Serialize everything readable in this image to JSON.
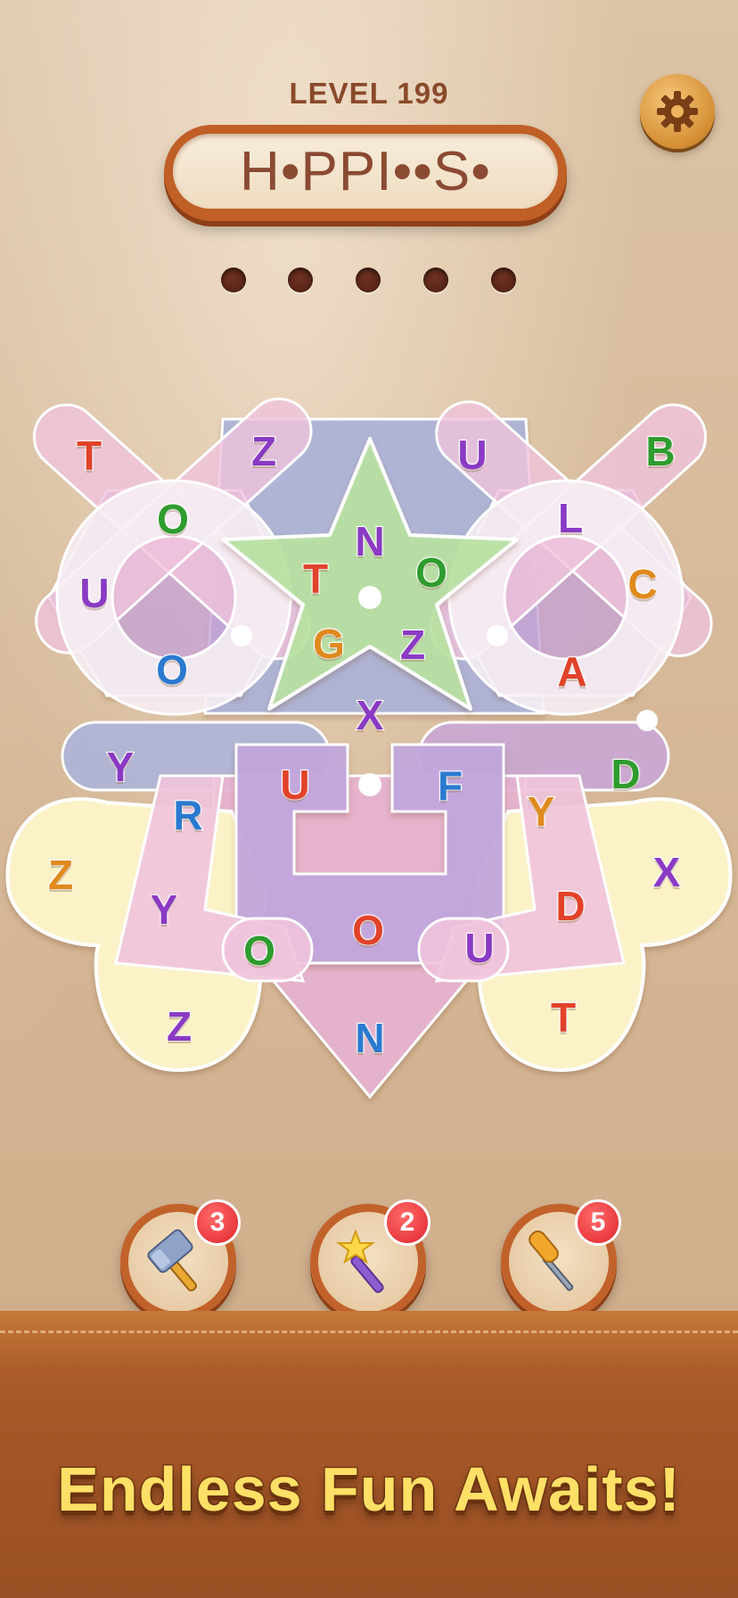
{
  "header": {
    "level_label": "LEVEL 199",
    "word_pattern": "H•PPI••S•",
    "settings_icon": "gear-icon"
  },
  "slots": {
    "count": 5
  },
  "board": {
    "letters": [
      {
        "char": "T",
        "color": "#e2422a"
      },
      {
        "char": "Z",
        "color": "#8a3ac4"
      },
      {
        "char": "U",
        "color": "#8a3ac4"
      },
      {
        "char": "B",
        "color": "#2e9c2e"
      },
      {
        "char": "O",
        "color": "#2e9c2e"
      },
      {
        "char": "N",
        "color": "#8a3ac4"
      },
      {
        "char": "L",
        "color": "#8a3ac4"
      },
      {
        "char": "U",
        "color": "#8a3ac4"
      },
      {
        "char": "T",
        "color": "#e2422a"
      },
      {
        "char": "O",
        "color": "#2e9c2e"
      },
      {
        "char": "C",
        "color": "#e08a1e"
      },
      {
        "char": "O",
        "color": "#2a7ad0"
      },
      {
        "char": "G",
        "color": "#e08a1e"
      },
      {
        "char": "Z",
        "color": "#8a3ac4"
      },
      {
        "char": "A",
        "color": "#e2422a"
      },
      {
        "char": "X",
        "color": "#8a3ac4"
      },
      {
        "char": "Y",
        "color": "#8a3ac4"
      },
      {
        "char": "U",
        "color": "#e2422a"
      },
      {
        "char": "F",
        "color": "#2a7ad0"
      },
      {
        "char": "D",
        "color": "#2e9c2e"
      },
      {
        "char": "R",
        "color": "#2a7ad0"
      },
      {
        "char": "Y",
        "color": "#e08a1e"
      },
      {
        "char": "Z",
        "color": "#e08a1e"
      },
      {
        "char": "X",
        "color": "#8a3ac4"
      },
      {
        "char": "Y",
        "color": "#8a3ac4"
      },
      {
        "char": "D",
        "color": "#e2422a"
      },
      {
        "char": "O",
        "color": "#2e9c2e"
      },
      {
        "char": "O",
        "color": "#e2422a"
      },
      {
        "char": "U",
        "color": "#8a3ac4"
      },
      {
        "char": "Z",
        "color": "#8a3ac4"
      },
      {
        "char": "N",
        "color": "#2a7ad0"
      },
      {
        "char": "T",
        "color": "#e2422a"
      }
    ]
  },
  "boosters": [
    {
      "name": "hammer-booster",
      "icon": "hammer-icon",
      "count": "3"
    },
    {
      "name": "magic-wand-booster",
      "icon": "magic-wand-icon",
      "count": "2"
    },
    {
      "name": "screwdriver-booster",
      "icon": "screwdriver-icon",
      "count": "5"
    }
  ],
  "tagline": "Endless Fun Awaits!"
}
